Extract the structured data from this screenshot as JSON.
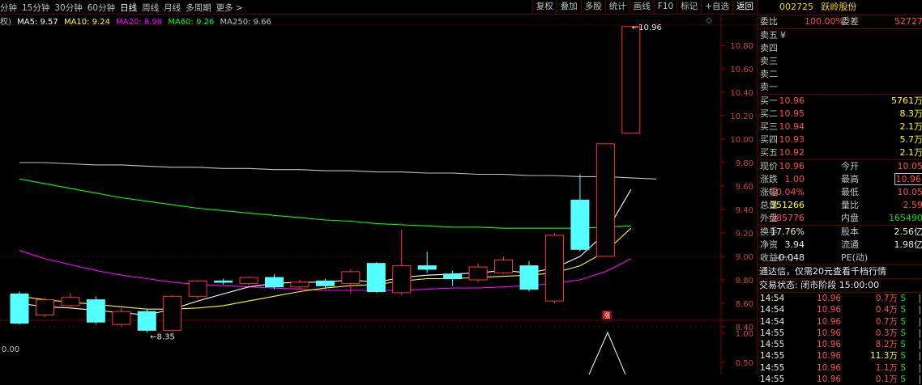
{
  "toolbar": {
    "periods": [
      "分钟",
      "15分钟",
      "30分钟",
      "60分钟",
      "日线",
      "周线",
      "月线",
      "多周期",
      "更多 >"
    ],
    "active_period": "日线",
    "tools": [
      "复权",
      "叠加",
      "多股",
      "统计",
      "画线",
      "F10",
      "标记",
      "+自选",
      "返回"
    ]
  },
  "chart_header": {
    "prefix": "权)",
    "ma5": "MA5: 9.57",
    "ma10": "MA10: 9.24",
    "ma20": "MA20: 8.98",
    "ma60": "MA60: 9.26",
    "ma250": "MA250: 9.66",
    "colors": {
      "ma5": "#ffffff",
      "ma10": "#ffff00",
      "ma20": "#ff00ff",
      "ma60": "#00ff00",
      "ma250": "#c0c0c0"
    }
  },
  "volume_header": "0.00",
  "chart_data": {
    "type": "candlestick",
    "y_ticks": [
      "10.80",
      "10.60",
      "10.40",
      "10.20",
      "10.00",
      "9.80",
      "9.60",
      "9.40",
      "9.20",
      "9.00",
      "8.80",
      "8.60",
      "8.40"
    ],
    "y_range": [
      8.3,
      11.0
    ],
    "candles": [
      {
        "open": 8.68,
        "close": 8.43,
        "high": 8.7,
        "low": 8.42
      },
      {
        "open": 8.5,
        "close": 8.63,
        "high": 8.65,
        "low": 8.48
      },
      {
        "open": 8.58,
        "close": 8.65,
        "high": 8.69,
        "low": 8.55
      },
      {
        "open": 8.63,
        "close": 8.44,
        "high": 8.66,
        "low": 8.42
      },
      {
        "open": 8.42,
        "close": 8.53,
        "high": 8.56,
        "low": 8.4
      },
      {
        "open": 8.53,
        "close": 8.37,
        "high": 8.55,
        "low": 8.35
      },
      {
        "open": 8.37,
        "close": 8.66,
        "high": 8.67,
        "low": 8.36
      },
      {
        "open": 8.66,
        "close": 8.79,
        "high": 8.8,
        "low": 8.64
      },
      {
        "open": 8.79,
        "close": 8.78,
        "high": 8.81,
        "low": 8.76
      },
      {
        "open": 8.77,
        "close": 8.82,
        "high": 8.83,
        "low": 8.75
      },
      {
        "open": 8.82,
        "close": 8.74,
        "high": 8.85,
        "low": 8.72
      },
      {
        "open": 8.74,
        "close": 8.78,
        "high": 8.8,
        "low": 8.72
      },
      {
        "open": 8.79,
        "close": 8.75,
        "high": 8.81,
        "low": 8.72
      },
      {
        "open": 8.77,
        "close": 8.87,
        "high": 8.89,
        "low": 8.68
      },
      {
        "open": 8.94,
        "close": 8.7,
        "high": 8.95,
        "low": 8.69
      },
      {
        "open": 8.69,
        "close": 8.92,
        "high": 9.23,
        "low": 8.67
      },
      {
        "open": 8.92,
        "close": 8.89,
        "high": 9.04,
        "low": 8.86
      },
      {
        "open": 8.85,
        "close": 8.81,
        "high": 8.88,
        "low": 8.75
      },
      {
        "open": 8.8,
        "close": 8.91,
        "high": 8.94,
        "low": 8.78
      },
      {
        "open": 8.86,
        "close": 8.97,
        "high": 9.0,
        "low": 8.85
      },
      {
        "open": 8.92,
        "close": 8.72,
        "high": 8.96,
        "low": 8.7
      },
      {
        "open": 8.62,
        "close": 9.18,
        "high": 9.2,
        "low": 8.6
      },
      {
        "open": 9.48,
        "close": 9.06,
        "high": 9.7,
        "low": 9.04
      },
      {
        "open": 9.0,
        "close": 9.96,
        "high": 9.96,
        "low": 9.0
      },
      {
        "open": 10.05,
        "close": 10.96,
        "high": 10.96,
        "low": 10.05
      }
    ],
    "ma5": [
      8.6,
      8.57,
      8.56,
      8.54,
      8.52,
      8.5,
      8.55,
      8.62,
      8.68,
      8.74,
      8.77,
      8.78,
      8.78,
      8.8,
      8.78,
      8.82,
      8.84,
      8.85,
      8.86,
      8.88,
      8.86,
      8.9,
      9.0,
      9.2,
      9.57
    ],
    "ma10": [
      8.66,
      8.63,
      8.61,
      8.59,
      8.57,
      8.55,
      8.55,
      8.56,
      8.58,
      8.62,
      8.66,
      8.7,
      8.73,
      8.75,
      8.76,
      8.79,
      8.81,
      8.81,
      8.82,
      8.83,
      8.84,
      8.86,
      8.92,
      9.04,
      9.24
    ],
    "ma20": [
      9.05,
      8.98,
      8.93,
      8.88,
      8.84,
      8.81,
      8.78,
      8.76,
      8.75,
      8.74,
      8.73,
      8.72,
      8.71,
      8.71,
      8.71,
      8.71,
      8.72,
      8.73,
      8.73,
      8.74,
      8.75,
      8.77,
      8.8,
      8.87,
      8.98
    ],
    "ma60": [
      9.66,
      9.62,
      9.58,
      9.54,
      9.5,
      9.47,
      9.44,
      9.41,
      9.39,
      9.37,
      9.35,
      9.33,
      9.31,
      9.3,
      9.28,
      9.27,
      9.26,
      9.25,
      9.25,
      9.24,
      9.24,
      9.24,
      9.24,
      9.25,
      9.26
    ],
    "ma250": [
      9.8,
      9.79,
      9.78,
      9.78,
      9.77,
      9.76,
      9.76,
      9.75,
      9.75,
      9.74,
      9.74,
      9.73,
      9.73,
      9.72,
      9.72,
      9.71,
      9.71,
      9.7,
      9.7,
      9.69,
      9.69,
      9.68,
      9.68,
      9.67,
      9.66
    ],
    "annotations": {
      "high_label": "10.96",
      "low_label": "8.35",
      "limit_up_mark": "涨"
    },
    "volume_ticks": [
      "1.00",
      "0.50"
    ]
  },
  "quote": {
    "code": "002725",
    "name": "跃岭股份",
    "weibi_label": "委比",
    "weibi_value": "100.00%",
    "weicha_label": "委差",
    "weicha_value": "52727",
    "sell": [
      {
        "label": "卖五",
        "price": "¥",
        "vol": ""
      },
      {
        "label": "卖四",
        "price": "",
        "vol": ""
      },
      {
        "label": "卖三",
        "price": "",
        "vol": ""
      },
      {
        "label": "卖二",
        "price": "",
        "vol": ""
      },
      {
        "label": "卖一",
        "price": "",
        "vol": ""
      }
    ],
    "buy": [
      {
        "label": "买一",
        "price": "10.96",
        "vol": "5761万"
      },
      {
        "label": "买二",
        "price": "10.95",
        "vol": "8.3万"
      },
      {
        "label": "买三",
        "price": "10.94",
        "vol": "2.1万"
      },
      {
        "label": "买四",
        "price": "10.93",
        "vol": "5.7万"
      },
      {
        "label": "买五",
        "price": "10.92",
        "vol": "2.1万"
      }
    ],
    "stats": [
      {
        "l1": "现价",
        "v1": "10.96",
        "c1": "red",
        "l2": "今开",
        "v2": "10.05",
        "c2": "red"
      },
      {
        "l1": "涨跌",
        "v1": "1.00",
        "c1": "red",
        "l2": "最高",
        "v2": "10.96",
        "c2": "red",
        "boxed": true
      },
      {
        "l1": "涨幅",
        "v1": "10.04%",
        "c1": "red",
        "l2": "最低",
        "v2": "10.05",
        "c2": "red"
      },
      {
        "l1": "总量",
        "v1": "351266",
        "c1": "yellow",
        "l2": "量比",
        "v2": "2.59",
        "c2": "red"
      },
      {
        "l1": "外盘",
        "v1": "185776",
        "c1": "red",
        "l2": "内盘",
        "v2": "165490",
        "c2": "green"
      }
    ],
    "stats2": [
      {
        "l1": "换手",
        "v1": "17.76%",
        "c1": "white",
        "l2": "股本",
        "v2": "2.56亿",
        "c2": "white"
      },
      {
        "l1": "净资",
        "v1": "3.94",
        "c1": "white",
        "l2": "流通",
        "v2": "1.98亿",
        "c2": "white"
      },
      {
        "l1": "收益(一)",
        "v1": "-0.048",
        "c1": "white",
        "l2": "PE(动)",
        "v2": "",
        "c2": "white"
      }
    ],
    "promo": "通达信，仅需20元查看千档行情",
    "status": "交易状态: 闭市阶段 15:00:00",
    "trades": [
      {
        "time": "14:54",
        "price": "10.96",
        "vol": "0.7万",
        "dir": "S",
        "yellow": false
      },
      {
        "time": "14:54",
        "price": "10.96",
        "vol": "0.4万",
        "dir": "S",
        "yellow": false
      },
      {
        "time": "14:54",
        "price": "10.96",
        "vol": "0.7万",
        "dir": "S",
        "yellow": false
      },
      {
        "time": "14:55",
        "price": "10.96",
        "vol": "0.3万",
        "dir": "S",
        "yellow": false
      },
      {
        "time": "14:55",
        "price": "10.96",
        "vol": "8.2万",
        "dir": "S",
        "yellow": false
      },
      {
        "time": "14:55",
        "price": "10.96",
        "vol": "11.3万",
        "dir": "S",
        "yellow": true
      },
      {
        "time": "14:55",
        "price": "10.96",
        "vol": "1.1万",
        "dir": "S",
        "yellow": false
      },
      {
        "time": "14:55",
        "price": "10.96",
        "vol": "0.1万",
        "dir": "S",
        "yellow": false
      }
    ]
  }
}
